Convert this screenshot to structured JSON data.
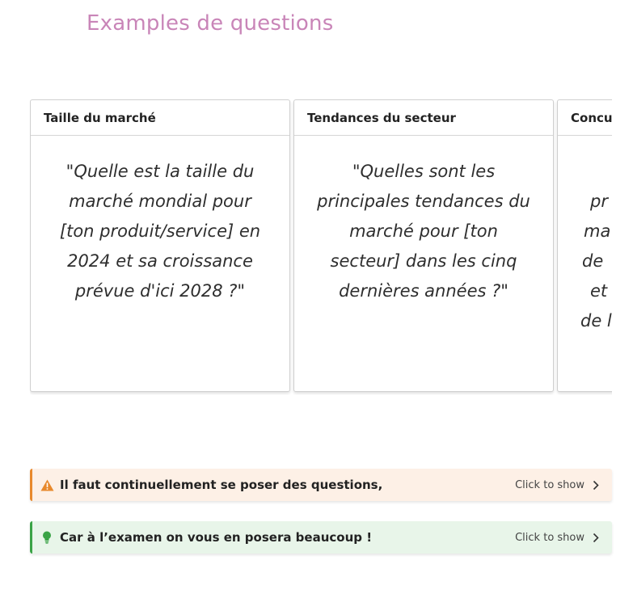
{
  "page": {
    "title": "Examples de questions"
  },
  "cards": [
    {
      "header": "Taille du marché",
      "body": "\"Quelle est la taille du marché mondial pour [ton produit/service] en 2024 et sa croissance prévue d'ici 2028 ?\""
    },
    {
      "header": "Tendances du secteur",
      "body": "\"Quelles sont les principales tendances du marché pour [ton secteur] dans les cinq dernières années ?\""
    },
    {
      "header": "Concu",
      "body": "pr ma de et de l"
    }
  ],
  "callouts": {
    "warning": {
      "icon": "warning-triangle-icon",
      "text": "Il faut continuellement se poser des questions,",
      "toggle_label": "Click to show",
      "accent_color": "#e8892c"
    },
    "tip": {
      "icon": "lightbulb-icon",
      "text": "Car à l’examen on vous en posera beaucoup !",
      "toggle_label": "Click to show",
      "accent_color": "#3aa346"
    }
  },
  "colors": {
    "title": "#c985b8"
  }
}
